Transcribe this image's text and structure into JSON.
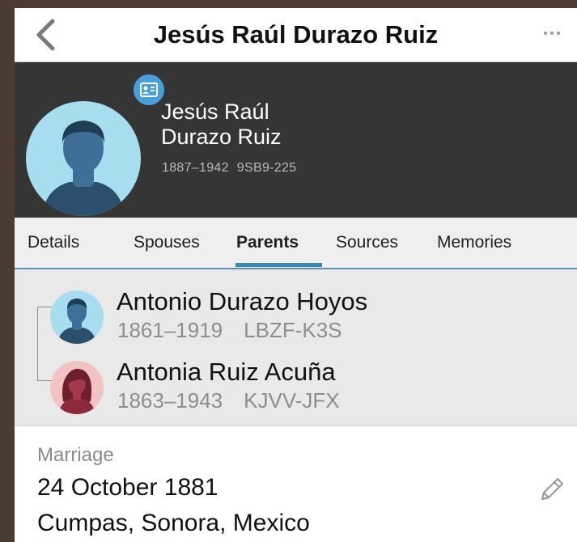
{
  "nav": {
    "title": "Jesús Raúl Durazo Ruiz",
    "back_icon": "chevron-left-icon",
    "more_icon": "more-dots-icon"
  },
  "person": {
    "name_line1": "Jesús Raúl",
    "name_line2": "Durazo Ruiz",
    "lifespan": "1887–1942",
    "id": "9SB9-225",
    "badge_icon": "id-card-icon"
  },
  "tabs": [
    {
      "label": "Details",
      "active": false
    },
    {
      "label": "Spouses",
      "active": false
    },
    {
      "label": "Parents",
      "active": true
    },
    {
      "label": "Sources",
      "active": false
    },
    {
      "label": "Memories",
      "active": false
    }
  ],
  "parents": [
    {
      "name": "Antonio Durazo Hoyos",
      "lifespan": "1861–1919",
      "id": "LBZF-K3S",
      "gender": "male"
    },
    {
      "name": "Antonia Ruiz Acuña",
      "lifespan": "1863–1943",
      "id": "KJVV-JFX",
      "gender": "female"
    }
  ],
  "event": {
    "label": "Marriage",
    "date": "24 October 1881",
    "place": "Cumpas, Sonora, Mexico",
    "edit_icon": "pencil-icon"
  },
  "colors": {
    "header_bg": "#353535",
    "accent": "#3f86b8",
    "male_avatar_bg": "#a6def0",
    "female_avatar_bg": "#f3c2c2"
  }
}
